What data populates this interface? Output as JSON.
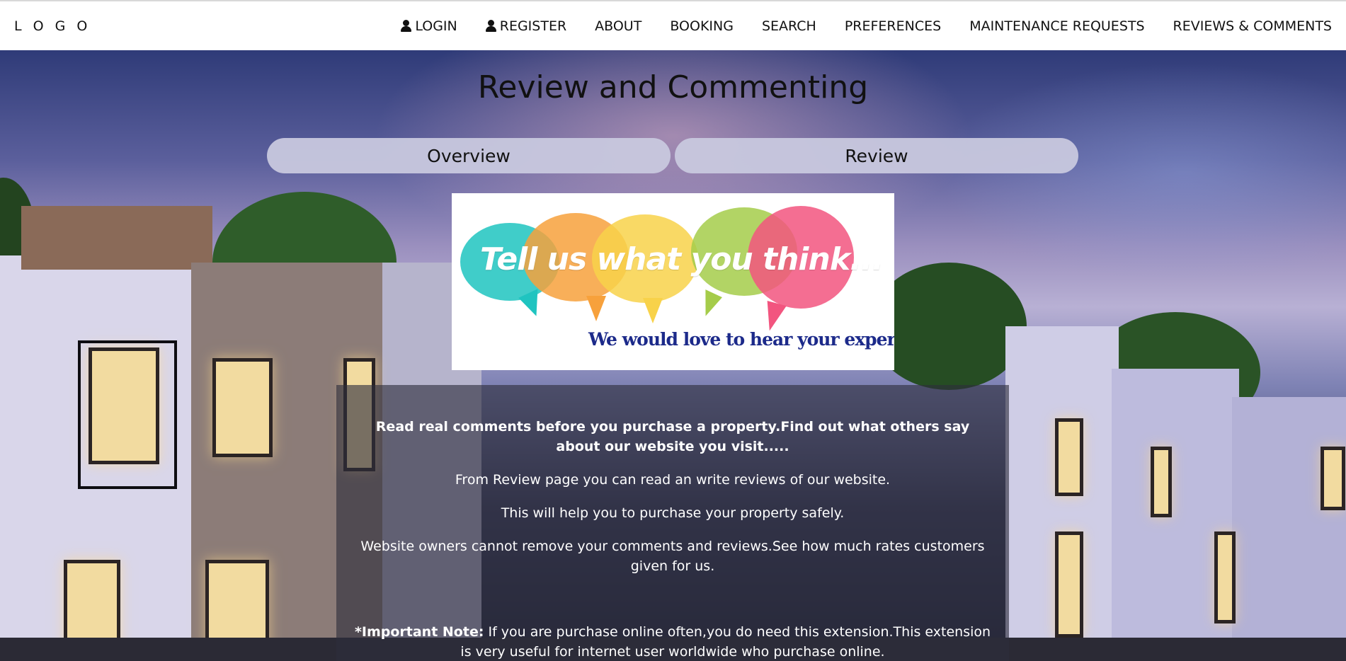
{
  "nav": {
    "logo": "L O G O",
    "links": [
      {
        "label": "LOGIN",
        "icon": "user-icon"
      },
      {
        "label": "REGISTER",
        "icon": "user-icon"
      },
      {
        "label": "ABOUT"
      },
      {
        "label": "BOOKING"
      },
      {
        "label": "SEARCH"
      },
      {
        "label": "PREFERENCES"
      },
      {
        "label": "MAINTENANCE REQUESTS"
      },
      {
        "label": "REVIEWS & COMMENTS"
      }
    ]
  },
  "page": {
    "title": "Review and Commenting"
  },
  "tabs": [
    {
      "label": "Overview"
    },
    {
      "label": "Review"
    }
  ],
  "promo": {
    "headline": "Tell us what you think...",
    "subline": "We would love to hear your experience!",
    "bubble_colors": [
      "#1fc4c0",
      "#f7a13c",
      "#f8d24a",
      "#a5cc4a",
      "#f2557f"
    ]
  },
  "info": {
    "heading": "Read real comments before you purchase a property.Find out what others say about our website you visit.....",
    "lines": [
      "From Review page you can read an write reviews of our website.",
      "This will help you to purchase your property safely.",
      "Website owners cannot remove your comments and reviews.See how much rates customers given for us."
    ],
    "note_label": "*Important Note:",
    "note_text": " If you are purchase online often,you do need this extension.This extension is very useful for internet user worldwide who purchase online."
  },
  "colors": {
    "navbar_bg": "#ffffff",
    "tab_bg": "#c8c8de",
    "panel_bg": "rgba(45,45,60,0.62)",
    "promo_subline": "#1c2a8a"
  }
}
